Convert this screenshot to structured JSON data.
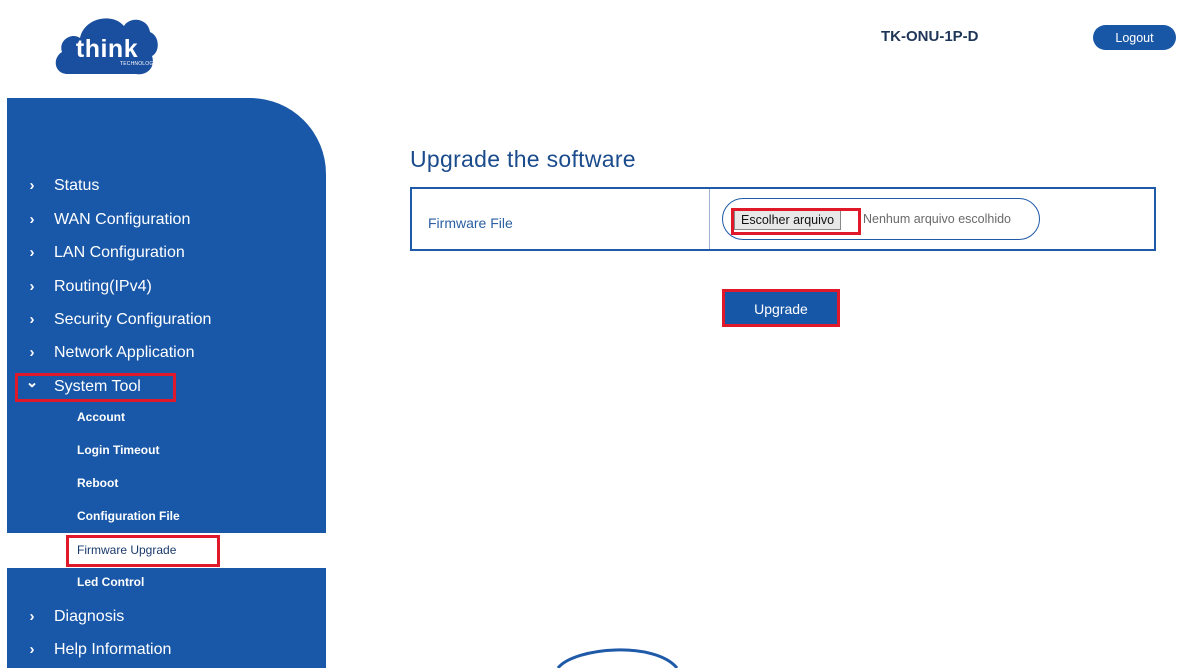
{
  "header": {
    "logo_text": "think",
    "logo_subtext": "TECHNOLOGY",
    "device_name": "TK-ONU-1P-D",
    "logout_label": "Logout"
  },
  "sidebar": {
    "items": [
      {
        "label": "Status",
        "chevron": "›"
      },
      {
        "label": "WAN Configuration",
        "chevron": "›"
      },
      {
        "label": "LAN Configuration",
        "chevron": "›"
      },
      {
        "label": "Routing(IPv4)",
        "chevron": "›"
      },
      {
        "label": "Security Configuration",
        "chevron": "›"
      },
      {
        "label": "Network Application",
        "chevron": "›"
      },
      {
        "label": "System Tool",
        "chevron": "⌄"
      },
      {
        "label": "Diagnosis",
        "chevron": "›"
      },
      {
        "label": "Help Information",
        "chevron": "›"
      }
    ],
    "system_tool_subitems": [
      {
        "label": "Account"
      },
      {
        "label": "Login Timeout"
      },
      {
        "label": "Reboot"
      },
      {
        "label": "Configuration File"
      },
      {
        "label": "Firmware Upgrade",
        "active": true
      },
      {
        "label": "Led Control"
      }
    ]
  },
  "main": {
    "title": "Upgrade the software",
    "firmware_label": "Firmware File",
    "choose_file_label": "Escolher arquivo",
    "no_file_text": "Nenhum arquivo escolhido",
    "upgrade_label": "Upgrade"
  },
  "colors": {
    "sidebar_bg": "#1958a8",
    "accent": "#1757a7",
    "highlight": "#e0192a"
  }
}
